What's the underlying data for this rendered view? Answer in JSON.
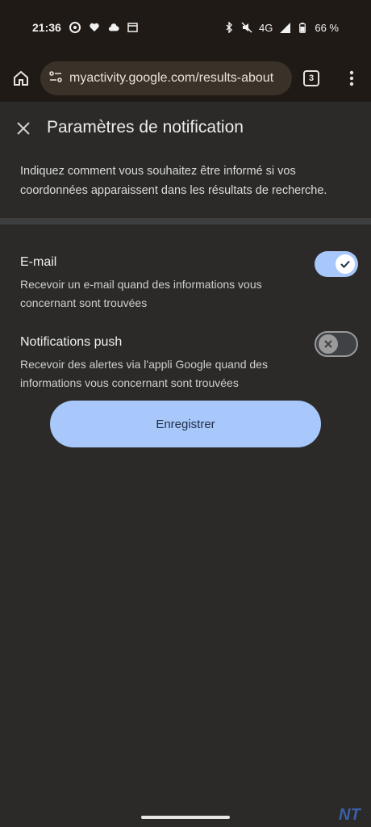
{
  "status_bar": {
    "time": "21:36",
    "network": "4G",
    "battery": "66 %"
  },
  "browser": {
    "url": "myactivity.google.com/results-about",
    "tab_count": "3"
  },
  "dialog": {
    "title": "Paramètres de notification",
    "intro": "Indiquez comment vous souhaitez être informé si vos coordonnées apparaissent dans les résultats de recherche."
  },
  "settings": [
    {
      "title": "E-mail",
      "description": "Recevoir un e-mail quand des informations vous concernant sont trouvées",
      "enabled": true
    },
    {
      "title": "Notifications push",
      "description": "Recevoir des alertes via l'appli Google quand des informations vous concernant sont trouvées",
      "enabled": false
    }
  ],
  "save_button": "Enregistrer",
  "watermark": "NT",
  "colors": {
    "accent": "#a8c7fa",
    "background": "#2b2a29",
    "toolbar": "#1f1a16"
  }
}
